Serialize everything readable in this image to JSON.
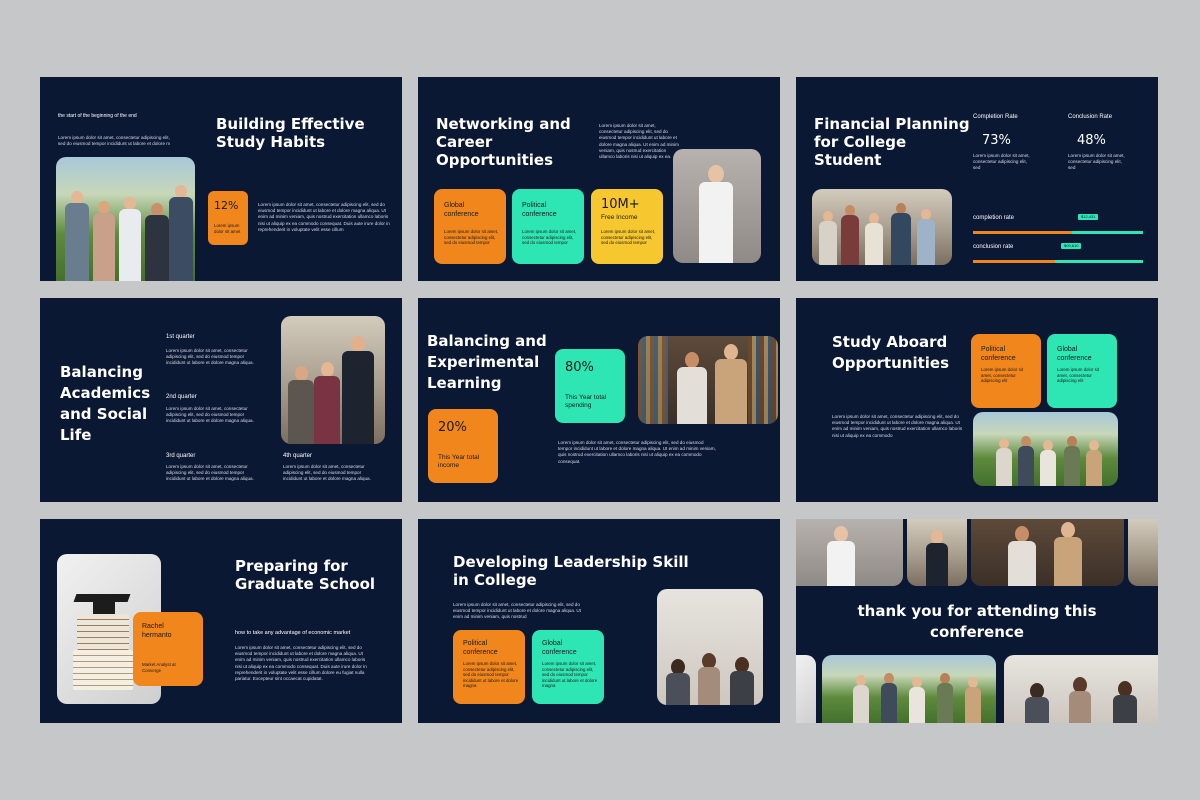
{
  "slide1": {
    "tagline": "the start of the beginning of the end",
    "intro": "Lorem ipsum dolor sit amet, consectetur adipiscing elit, sed do eiusmod tempor incididunt ut labore et dolore m",
    "title": "Building Effective Study Habits",
    "stat_value": "12%",
    "stat_text": "Lorem ipsum dolor sit amet",
    "body": "Lorem ipsum dolor sit amet, consectetur adipiscing elit, sed do eiusmod tempor incididunt ut labore et dolore magna aliqua. Ut enim ad minim veniam, quis nostrud exercitation ullamco laboris nisi ut aliquip ex ea commodo consequat. Duis aute irure dolor in reprehenderit in voluptate velit esse cillum"
  },
  "slide2": {
    "title": "Networking and Career Opportunities",
    "body": "Lorem ipsum dolor sit amet, consectetur adipiscing elit, sed do eiusmod tempor incididunt ut labore et dolore magna aliqua. Ut enim ad minim veniam, quis nostrud exercitation ullamco laboris nisi ut aliquip ex ea.",
    "card1_title": "Global conference",
    "card1_text": "Lorem ipsum dolor sit amet, consectetur adipiscing elit, sed do eiusmod tempor",
    "card2_title": "Political conference",
    "card2_text": "Lorem ipsum dolor sit amet, consectetur adipiscing elit, sed do eiusmod tempor",
    "card3_value": "10M+",
    "card3_title": "Free Income",
    "card3_text": "Lorem ipsum dolor sit amet, consectetur adipiscing elit, sed do eiusmod tempor"
  },
  "slide3": {
    "title": "Financial Planning for College Student",
    "stat1_label": "Completion Rate",
    "stat1_value": "73%",
    "stat1_text": "Lorem ipsum dolor sit amet, consectetur adipiscing elit, sed",
    "stat2_label": "Conclusion Rate",
    "stat2_value": "48%",
    "stat2_text": "Lorem ipsum dolor sit amet, consectetur adipiscing elit, sed",
    "bar1_label": "completion rate",
    "bar1_tag": "$12,431",
    "bar1_progress": 0.58,
    "bar2_label": "conclusion rate",
    "bar2_tag": "$09,610",
    "bar2_progress": 0.48
  },
  "slide4": {
    "title": "Balancing Academics and Social Life",
    "q1": "1st quarter",
    "q2": "2nd quarter",
    "q3": "3rd quarter",
    "q4": "4th quarter",
    "q_text": "Lorem ipsum dolor sit amet, consectetur adipiscing elit, sed do eiusmod tempor incididunt ut labore et dolore magna aliqua."
  },
  "slide5": {
    "title": "Balancing and Experimental Learning",
    "card1_value": "80%",
    "card1_text": "This Year total spending",
    "card2_value": "20%",
    "card2_text": "This Year total income",
    "body": "Lorem ipsum dolor sit amet, consectetur adipiscing elit, sed do eiusmod tempor incididunt ut labore et dolore magna aliqua. Ut enim ad minim veniam, quis nostrud exercitation ullamco laboris nisi ut aliquip ex ea commodo consequat."
  },
  "slide6": {
    "title": "Study Aboard Opportunities",
    "card1_title": "Political conference",
    "card1_text": "Lorem ipsum dolor sit amet, consectetur adipiscing elit",
    "card2_title": "Global conference",
    "card2_text": "Lorem ipsum dolor sit amet, consectetur adipiscing elit",
    "body": "Lorem ipsum dolor sit amet, consectetur adipiscing elit, sed do eiusmod tempor incididunt ut labore et dolore magna aliqua. Ut enim ad minim veniam, quis nostrud exercitation ullamco laboris nisi ut aliquip ex ea commodo"
  },
  "slide7": {
    "title": "Preparing for Graduate School",
    "name": "Rachel hermanto",
    "role": "Market Analyst at Converge",
    "subtitle": "how to take any advantage of economic market",
    "body": "Lorem ipsum dolor sit amet, consectetur adipiscing elit, sed do eiusmod tempor incididunt ut labore et dolore magna aliqua. Ut enim ad minim veniam, quis nostrud exercitation ullamco laboris nisi ut aliquip ex ea commodo consequat. Duis aute irure dolor in reprehenderit in voluptate velit esse cillum dolore eu fugiat nulla pariatur. Excepteur sint occaecat cupidatat."
  },
  "slide8": {
    "title": "Developing Leadership Skill in College",
    "body": "Lorem ipsum dolor sit amet, consectetur adipiscing elit, sed do eiusmod tempor incididunt ut labore et dolore magna aliqua. Ut enim ad minim veniam, quis nostrud",
    "card1_title": "Political conference",
    "card1_text": "Lorem ipsum dolor sit amet, consectetur adipiscing elit, sed do eiusmod tempor incididunt ut labore et dolore magna",
    "card2_title": "Global conference",
    "card2_text": "Lorem ipsum dolor sit amet, consectetur adipiscing elit, sed do eiusmod tempor incididunt ut labore et dolore magna"
  },
  "slide9": {
    "title": "thank you for attending this conference"
  },
  "colors": {
    "background": "#c6c7c9",
    "slide": "#0b1834",
    "orange": "#f0861c",
    "green": "#2ee6b4",
    "yellow": "#f7c730"
  }
}
